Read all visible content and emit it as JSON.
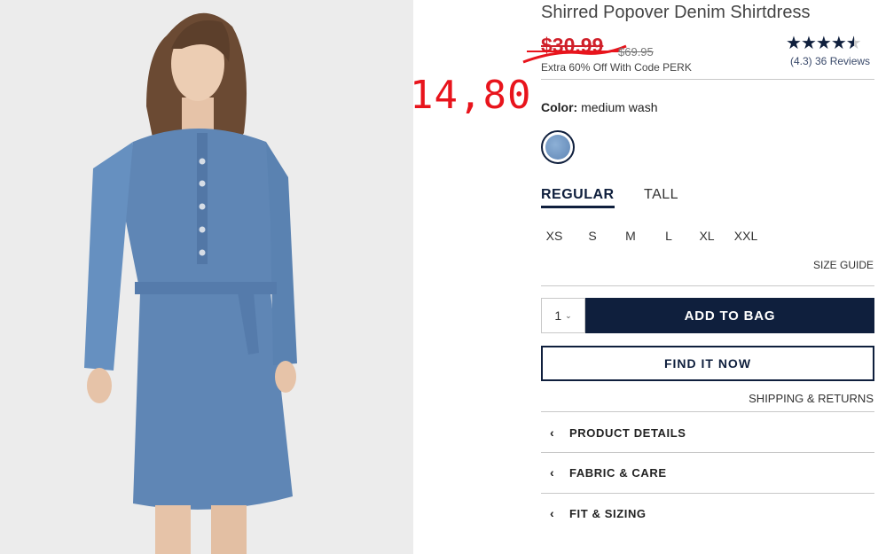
{
  "product": {
    "title": "Shirred Popover Denim Shirtdress",
    "sale_price": "$30.99",
    "original_price": "$69.95",
    "promo": "Extra 60% Off With Code PERK",
    "overlay_price": "14,80"
  },
  "rating": {
    "value": 4.3,
    "stars_full": 4,
    "text": "(4.3) 36 Reviews"
  },
  "color": {
    "label": "Color:",
    "value": "medium wash"
  },
  "fit_tabs": [
    {
      "label": "REGULAR",
      "selected": true
    },
    {
      "label": "TALL",
      "selected": false
    }
  ],
  "sizes": [
    "XS",
    "S",
    "M",
    "L",
    "XL",
    "XXL"
  ],
  "size_guide": "SIZE GUIDE",
  "quantity": {
    "value": "1"
  },
  "buttons": {
    "add_to_bag": "ADD TO BAG",
    "find_it_now": "FIND IT NOW"
  },
  "shipping_link": "SHIPPING & RETURNS",
  "accordion": [
    "PRODUCT DETAILS",
    "FABRIC & CARE",
    "FIT & SIZING"
  ],
  "colors": {
    "navy": "#0f1f3d",
    "sale_red": "#d0202a",
    "overlay_red": "#e8141c",
    "denim": "#5f86b5"
  }
}
